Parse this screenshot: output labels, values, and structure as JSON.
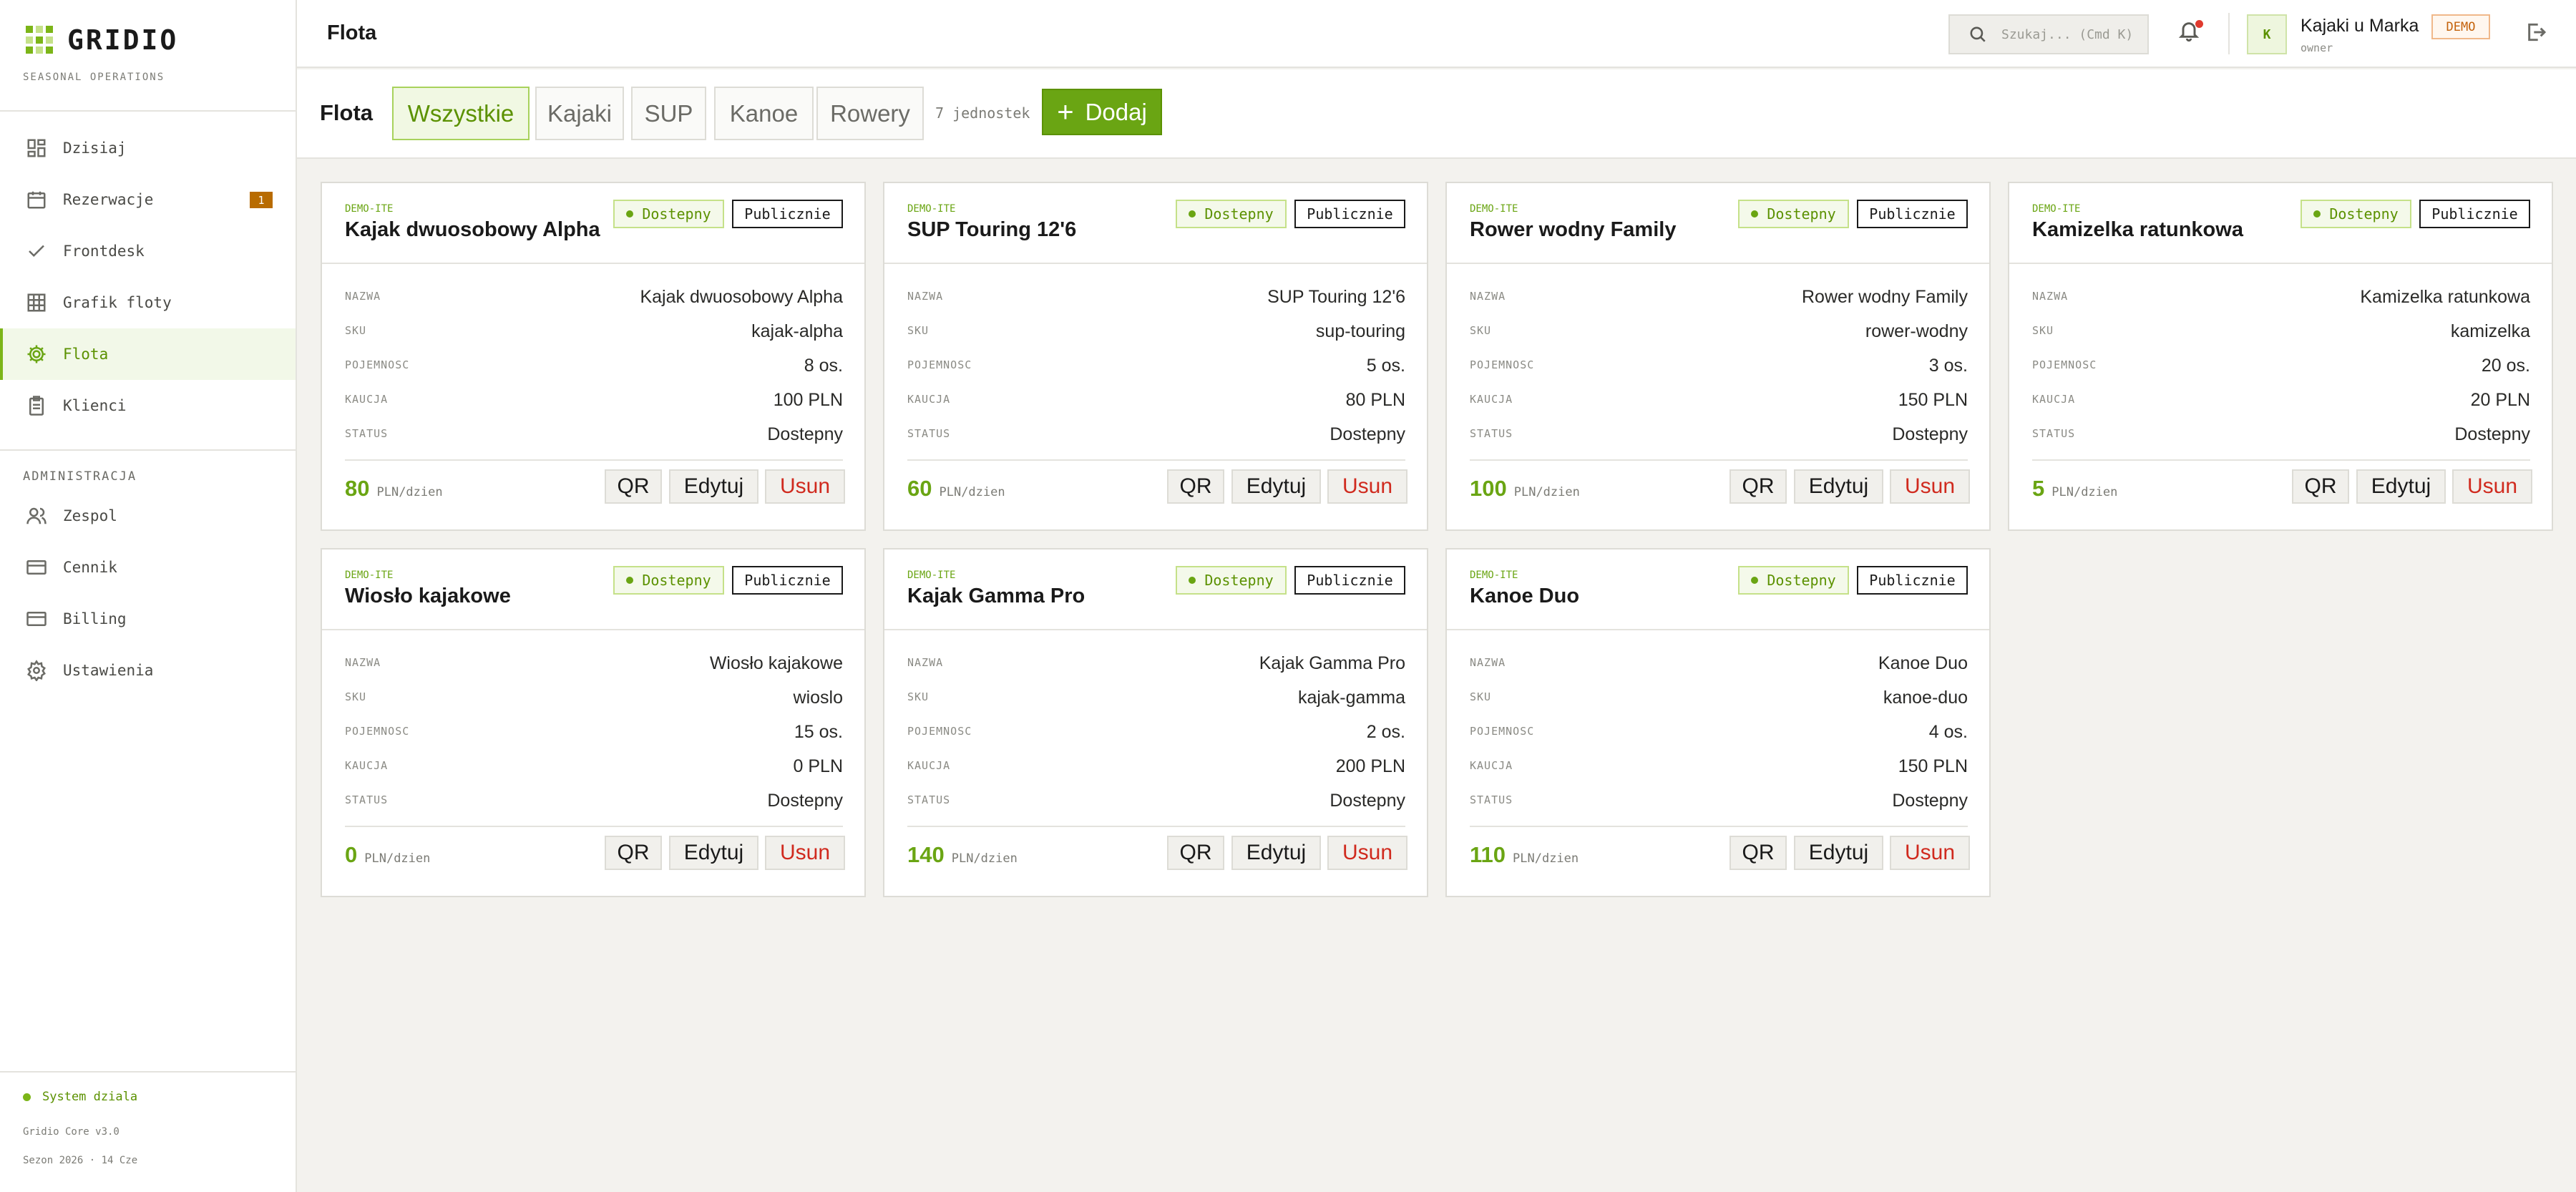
{
  "brand": {
    "name": "GRIDIO",
    "subtitle": "SEASONAL OPERATIONS"
  },
  "sidebar": {
    "items": [
      {
        "label": "Dzisiaj",
        "icon": "dashboard-icon"
      },
      {
        "label": "Rezerwacje",
        "icon": "calendar-icon",
        "badge": "1"
      },
      {
        "label": "Frontdesk",
        "icon": "check-icon"
      },
      {
        "label": "Grafik floty",
        "icon": "grid-icon"
      },
      {
        "label": "Flota",
        "icon": "gear-icon",
        "active": true
      },
      {
        "label": "Klienci",
        "icon": "clipboard-icon"
      }
    ],
    "admin_label": "ADMINISTRACJA",
    "admin_items": [
      {
        "label": "Zespol",
        "icon": "users-icon"
      },
      {
        "label": "Cennik",
        "icon": "card-icon"
      },
      {
        "label": "Billing",
        "icon": "card-icon"
      },
      {
        "label": "Ustawienia",
        "icon": "settings-icon"
      }
    ],
    "status": "System dziala",
    "version": "Gridio Core v3.0",
    "season": "Sezon 2026 · 14 Cze"
  },
  "header": {
    "title": "Flota",
    "search_placeholder": "Szukaj... (Cmd K)",
    "user_initial": "K",
    "user_name": "Kajaki u Marka",
    "user_role": "owner",
    "demo_badge": "DEMO"
  },
  "filter": {
    "title": "Flota",
    "tabs": [
      "Wszystkie",
      "Kajaki",
      "SUP",
      "Kanoe",
      "Rowery"
    ],
    "active_tab": "Wszystkie",
    "count": "7 jednostek",
    "add_label": "Dodaj"
  },
  "labels": {
    "name": "NAZWA",
    "sku": "SKU",
    "capacity": "POJEMNOSC",
    "deposit": "KAUCJA",
    "status": "STATUS",
    "price_unit": "PLN/dzien",
    "available": "Dostepny",
    "public": "Publicznie",
    "qr": "QR",
    "edit": "Edytuj",
    "delete": "Usun"
  },
  "items": [
    {
      "code": "DEMO-ITE",
      "title": "Kajak dwuosobowy Alpha",
      "name": "Kajak dwuosobowy Alpha",
      "sku": "kajak-alpha",
      "capacity": "8 os.",
      "deposit": "100 PLN",
      "status": "Dostepny",
      "price": "80"
    },
    {
      "code": "DEMO-ITE",
      "title": "SUP Touring 12'6",
      "name": "SUP Touring 12'6",
      "sku": "sup-touring",
      "capacity": "5 os.",
      "deposit": "80 PLN",
      "status": "Dostepny",
      "price": "60"
    },
    {
      "code": "DEMO-ITE",
      "title": "Rower wodny Family",
      "name": "Rower wodny Family",
      "sku": "rower-wodny",
      "capacity": "3 os.",
      "deposit": "150 PLN",
      "status": "Dostepny",
      "price": "100"
    },
    {
      "code": "DEMO-ITE",
      "title": "Kamizelka ratunkowa",
      "name": "Kamizelka ratunkowa",
      "sku": "kamizelka",
      "capacity": "20 os.",
      "deposit": "20 PLN",
      "status": "Dostepny",
      "price": "5"
    },
    {
      "code": "DEMO-ITE",
      "title": "Wiosło kajakowe",
      "name": "Wiosło kajakowe",
      "sku": "wioslo",
      "capacity": "15 os.",
      "deposit": "0 PLN",
      "status": "Dostepny",
      "price": "0"
    },
    {
      "code": "DEMO-ITE",
      "title": "Kajak Gamma Pro",
      "name": "Kajak Gamma Pro",
      "sku": "kajak-gamma",
      "capacity": "2 os.",
      "deposit": "200 PLN",
      "status": "Dostepny",
      "price": "140"
    },
    {
      "code": "DEMO-ITE",
      "title": "Kanoe Duo",
      "name": "Kanoe Duo",
      "sku": "kanoe-duo",
      "capacity": "4 os.",
      "deposit": "150 PLN",
      "status": "Dostepny",
      "price": "110"
    }
  ],
  "colors": {
    "accent": "#6aa513",
    "danger": "#d02a1e",
    "warning": "#b86b00"
  }
}
